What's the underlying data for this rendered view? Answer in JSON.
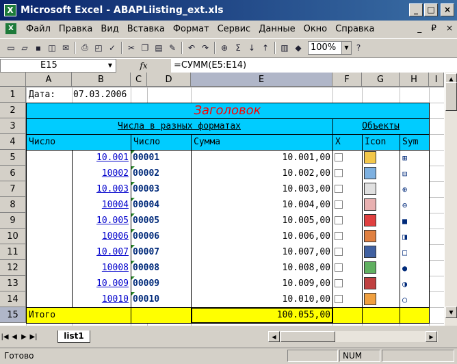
{
  "window": {
    "title": "Microsoft Excel - ABAPLiisting_ext.xls",
    "app_icon": "X",
    "min": "_",
    "max": "□",
    "close": "×"
  },
  "menu": {
    "items": [
      "Файл",
      "Правка",
      "Вид",
      "Вставка",
      "Формат",
      "Сервис",
      "Данные",
      "Окно",
      "Справка"
    ],
    "doc_min": "_",
    "doc_restore": "₽",
    "doc_close": "×"
  },
  "toolbar": {
    "zoom": "100%",
    "sigma": "Σ"
  },
  "formula_bar": {
    "cell_ref": "E15",
    "fx": "fx",
    "formula": "=СУММ(E5:E14)"
  },
  "columns": [
    "A",
    "B",
    "C",
    "D",
    "E",
    "F",
    "G",
    "H",
    "I"
  ],
  "rows": [
    "1",
    "2",
    "3",
    "4",
    "5",
    "6",
    "7",
    "8",
    "9",
    "10",
    "11",
    "12",
    "13",
    "14",
    "15"
  ],
  "sheet": {
    "date_label": "Дата:",
    "date_value": "07.03.2006",
    "heading": "Заголовок",
    "group_numbers": "Числа в разных форматах",
    "group_objects": "Объекты",
    "hdr_number": "Число",
    "hdr_number2": "Число",
    "hdr_sum": "Сумма",
    "hdr_x": "X",
    "hdr_icon": "Icon",
    "hdr_sym": "Sym",
    "data": [
      {
        "b": "10.001",
        "c": "00001",
        "e": "10.001,00",
        "sym": "⊞"
      },
      {
        "b": "10002",
        "c": "00002",
        "e": "10.002,00",
        "sym": "⊟"
      },
      {
        "b": "10.003",
        "c": "00003",
        "e": "10.003,00",
        "sym": "⊕"
      },
      {
        "b": "10004",
        "c": "00004",
        "e": "10.004,00",
        "sym": "⊖"
      },
      {
        "b": "10.005",
        "c": "00005",
        "e": "10.005,00",
        "sym": "■"
      },
      {
        "b": "10006",
        "c": "00006",
        "e": "10.006,00",
        "sym": "◨"
      },
      {
        "b": "10.007",
        "c": "00007",
        "e": "10.007,00",
        "sym": "□"
      },
      {
        "b": "10008",
        "c": "00008",
        "e": "10.008,00",
        "sym": "●"
      },
      {
        "b": "10.009",
        "c": "00009",
        "e": "10.009,00",
        "sym": "◑"
      },
      {
        "b": "10010",
        "c": "00010",
        "e": "10.010,00",
        "sym": "○"
      }
    ],
    "icons": [
      "magnifier-clock-icon",
      "magnifier-doc-icon",
      "print-preview-icon",
      "copy-doc-icon",
      "filter-icon",
      "stamp-icon",
      "save-floppy-icon",
      "add-column-icon",
      "remove-column-icon",
      "edit-pencil-icon"
    ],
    "total_label": "Итого",
    "total_value": "100.055,00"
  },
  "sheet_tabs": [
    "list1"
  ],
  "status": {
    "ready": "Готово",
    "num": "NUM"
  },
  "colors": {
    "cyan": "#00ccff",
    "white_block": "#ffffff",
    "total": "#ffff00",
    "heading_text": "#ff0000",
    "link": "#0000cc"
  }
}
